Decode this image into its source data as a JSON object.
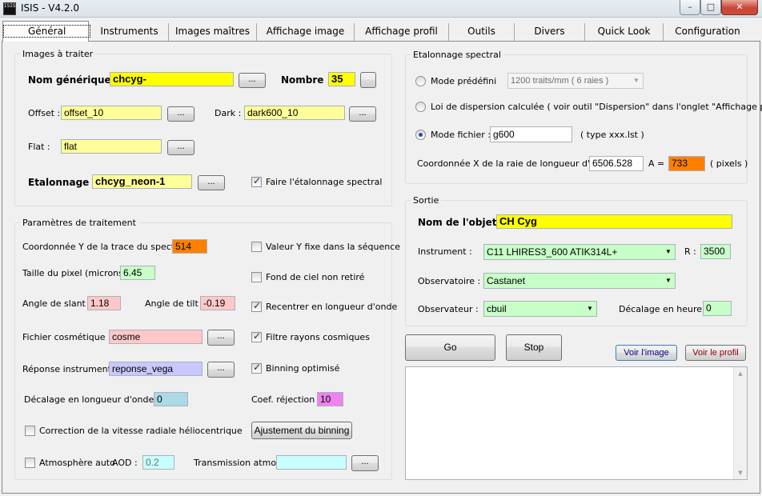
{
  "window": {
    "title": "ISIS - V4.2.0",
    "icon_text": "ISIS"
  },
  "tabs": [
    {
      "label": "Général"
    },
    {
      "label": "Instruments"
    },
    {
      "label": "Images maîtres"
    },
    {
      "label": "Affichage image"
    },
    {
      "label": "Affichage profil"
    },
    {
      "label": "Outils"
    },
    {
      "label": "Divers"
    },
    {
      "label": "Quick Look"
    },
    {
      "label": "Configuration"
    }
  ],
  "images": {
    "group_label": "Images à traiter",
    "nom_label": "Nom générique :",
    "nom_value": "chcyg-",
    "nombre_label": "Nombre :",
    "nombre_value": "35",
    "offset_label": "Offset :",
    "offset_value": "offset_10",
    "dark_label": "Dark :",
    "dark_value": "dark600_10",
    "flat_label": "Flat :",
    "flat_value": "flat",
    "etal_label": "Etalonnage :",
    "etal_value": "chcyg_neon-1",
    "faire_label": "Faire l'étalonnage spectral",
    "browse": "..."
  },
  "params": {
    "group_label": "Paramètres de traitement",
    "coordy_label": "Coordonnée Y de la trace du spectre :",
    "coordy_value": "514",
    "valy_label": "Valeur Y fixe dans la séquence",
    "taille_label": "Taille du pixel (microns) :",
    "taille_value": "6.45",
    "fond_label": "Fond de ciel non retiré",
    "slant_label": "Angle de slant :",
    "slant_value": "1.18",
    "tilt_label": "Angle de tilt :",
    "tilt_value": "-0.19",
    "recentrer_label": "Recentrer en longueur d'onde",
    "cosm_label": "Fichier cosmétique :",
    "cosm_value": "cosme",
    "filtre_label": "Filtre rayons cosmiques",
    "reponse_label": "Réponse instrument :",
    "reponse_value": "reponse_vega",
    "binning_label": "Binning optimisé",
    "decal_label": "Décalage en longueur d'onde (A) :",
    "decal_value": "0",
    "coef_label": "Coef. réjection :",
    "coef_value": "10",
    "correction_label": "Correction de la vitesse radiale héliocentrique",
    "ajustement_label": "Ajustement du binning",
    "atmo_label": "Atmosphère auto",
    "aod_label": "AOD :",
    "aod_value": "0.2",
    "transmission_label": "Transmission atmo. :",
    "transmission_value": ""
  },
  "etal": {
    "group_label": "Etalonnage spectral",
    "mode_predef_label": "Mode prédéfini",
    "mode_predef_value": "1200 traits/mm ( 6 raies )",
    "loi_label": "Loi de dispersion calculée ( voir outil \"Dispersion\" dans l'onglet \"Affichage profil\" )",
    "mode_fichier_label": "Mode fichier :",
    "mode_fichier_value": "g600",
    "type_hint": "( type xxx.lst )",
    "coordx_label": "Coordonnée X de la raie de longueur d'onde",
    "coordx_value": "6506.528",
    "a_eq": "A  =",
    "pixel_value": "733",
    "pixels_label": "( pixels )"
  },
  "sortie": {
    "group_label": "Sortie",
    "nom_objet_label": "Nom de l'objet :",
    "nom_objet_value": "CH Cyg",
    "instrument_label": "Instrument :",
    "instrument_value": "C11 LHIRES3_600 ATIK314L+",
    "r_label": "R :",
    "r_value": "3500",
    "obs_label": "Observatoire :",
    "obs_value": "Castanet",
    "observateur_label": "Observateur :",
    "observateur_value": "cbuil",
    "decal_heure_label": "Décalage en heure :",
    "decal_heure_value": "0"
  },
  "actions": {
    "go": "Go",
    "stop": "Stop",
    "voir_image": "Voir l'image",
    "voir_profil": "Voir le profil"
  }
}
